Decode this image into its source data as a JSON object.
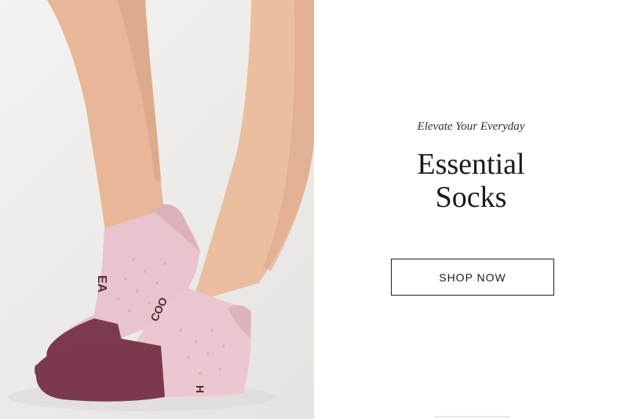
{
  "hero": {
    "eyebrow": "Elevate Your Everyday",
    "headline_line1": "Essential",
    "headline_line2": "Socks",
    "cta_label": "SHOP NOW"
  },
  "image": {
    "sock_text_left": "EA",
    "sock_text_right": "COO",
    "sock_text_heel": "H",
    "colors": {
      "sock_body": "#e9c8cf",
      "sock_toe": "#7b3b4c",
      "skin": "#e8b99a",
      "background": "#eeedeb"
    }
  }
}
